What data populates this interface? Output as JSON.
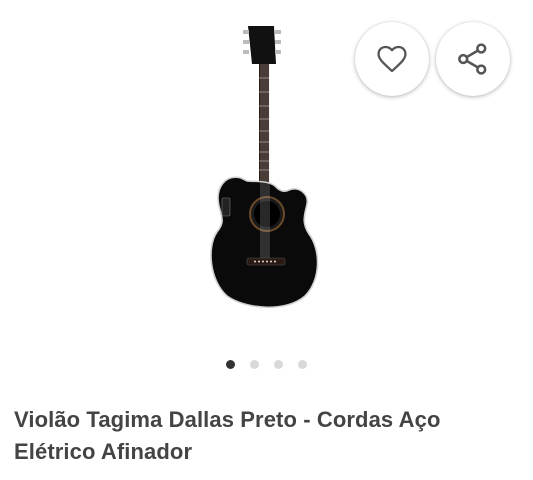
{
  "product": {
    "title": "Violão Tagima Dallas Preto - Cordas Aço Elétrico Afinador"
  },
  "gallery": {
    "image_count": 4,
    "active_index": 0
  },
  "actions": {
    "favorite_icon": "heart-icon",
    "share_icon": "share-icon"
  },
  "colors": {
    "title_text": "#444444",
    "dot_active": "#333333",
    "dot_inactive": "#d9d9d9"
  }
}
